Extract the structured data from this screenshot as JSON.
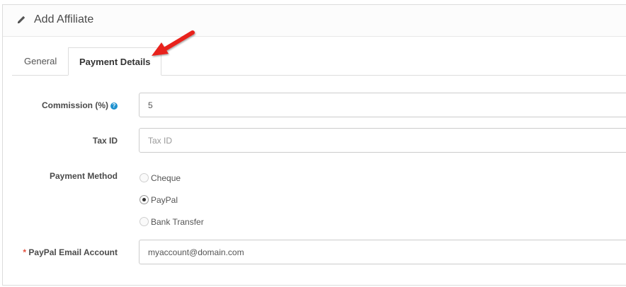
{
  "header": {
    "title": "Add Affiliate",
    "icon": "pencil-icon"
  },
  "tabs": [
    {
      "label": "General",
      "active": false
    },
    {
      "label": "Payment Details",
      "active": true
    }
  ],
  "annotation": {
    "arrow_color": "#e8231c"
  },
  "form": {
    "commission": {
      "label": "Commission (%)",
      "help": "?",
      "value": "5"
    },
    "tax_id": {
      "label": "Tax ID",
      "placeholder": "Tax ID",
      "value": ""
    },
    "payment_method": {
      "label": "Payment Method",
      "options": [
        {
          "label": "Cheque",
          "checked": false
        },
        {
          "label": "PayPal",
          "checked": true
        },
        {
          "label": "Bank Transfer",
          "checked": false
        }
      ]
    },
    "paypal_email": {
      "required_marker": "*",
      "label": "PayPal Email Account",
      "value": "myaccount@domain.com"
    }
  },
  "colors": {
    "help_icon": "#1e91cf",
    "required": "#e3503e"
  }
}
